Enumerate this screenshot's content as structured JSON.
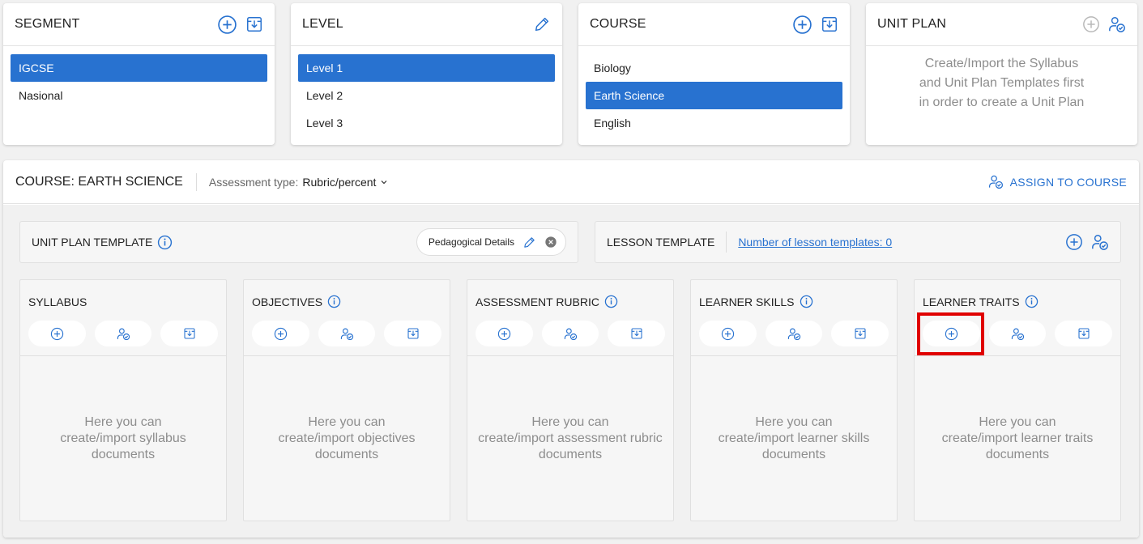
{
  "cards": {
    "segment": {
      "title": "SEGMENT",
      "items": [
        "IGCSE",
        "Nasional"
      ]
    },
    "level": {
      "title": "LEVEL",
      "items": [
        "Level 1",
        "Level 2",
        "Level 3"
      ]
    },
    "course": {
      "title": "COURSE",
      "items": [
        "Biology",
        "Earth Science",
        "English"
      ]
    },
    "unit_plan": {
      "title": "UNIT PLAN",
      "message": [
        "Create/Import the Syllabus",
        "and Unit Plan Templates first",
        "in order to create a Unit Plan"
      ]
    }
  },
  "main": {
    "course_title": "COURSE: EARTH SCIENCE",
    "assessment_label": "Assessment type:",
    "assessment_value": "Rubric/percent",
    "assign_label": "ASSIGN TO COURSE",
    "unit_plan_template": {
      "label": "UNIT PLAN TEMPLATE",
      "chip": "Pedagogical Details"
    },
    "lesson_template": {
      "label": "LESSON TEMPLATE",
      "link": "Number of lesson templates: 0"
    },
    "columns": [
      {
        "title": "SYLLABUS",
        "msg": [
          "Here you can",
          "create/import syllabus",
          "documents"
        ]
      },
      {
        "title": "OBJECTIVES",
        "msg": [
          "Here you can",
          "create/import objectives",
          "documents"
        ]
      },
      {
        "title": "ASSESSMENT RUBRIC",
        "msg": [
          "Here you can",
          "create/import assessment rubric",
          "documents"
        ]
      },
      {
        "title": "LEARNER SKILLS",
        "msg": [
          "Here you can",
          "create/import learner skills",
          "documents"
        ]
      },
      {
        "title": "LEARNER TRAITS",
        "msg": [
          "Here you can",
          "create/import learner traits",
          "documents"
        ]
      }
    ]
  },
  "colors": {
    "accent": "#2872d0",
    "highlight": "#e00000",
    "muted": "#8d8d8d"
  },
  "icons": [
    "plus-circle-icon",
    "import-icon",
    "pencil-icon",
    "assign-user-icon",
    "info-icon",
    "chevron-down-icon",
    "close-circle-icon"
  ]
}
